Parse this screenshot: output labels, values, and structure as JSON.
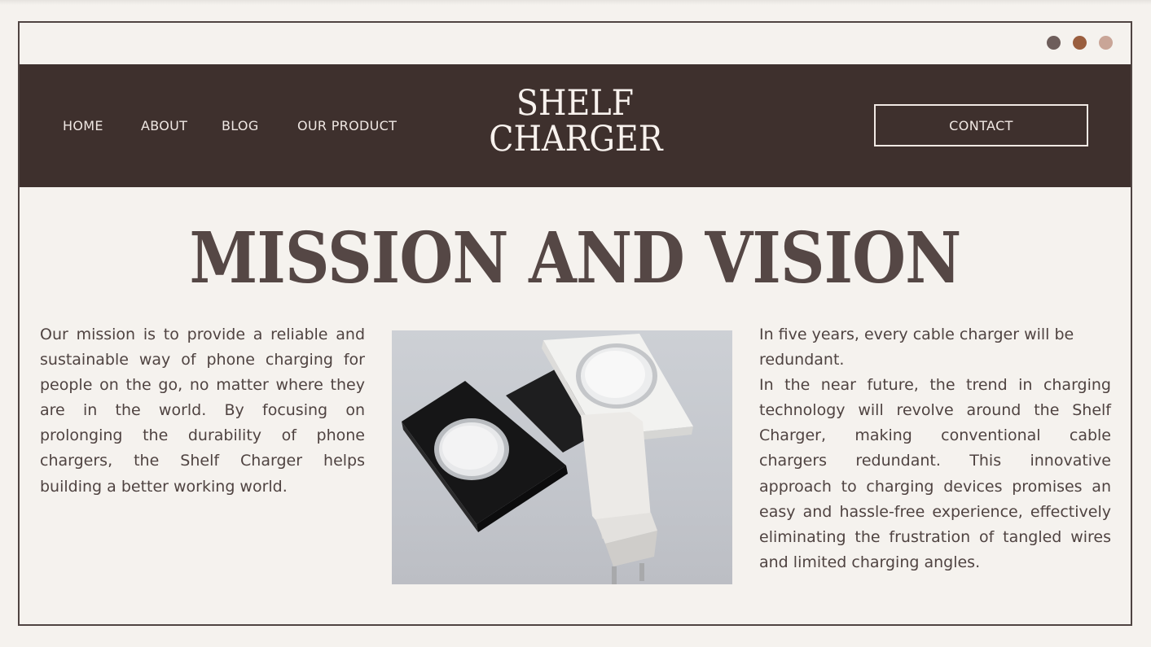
{
  "window": {
    "controls": [
      {
        "name": "control-dot-1",
        "color": "#6e5e5b"
      },
      {
        "name": "control-dot-2",
        "color": "#9a5e3e"
      },
      {
        "name": "control-dot-3",
        "color": "#c9a597"
      }
    ]
  },
  "nav": {
    "links": [
      "HOME",
      "ABOUT",
      "BLOG",
      "OUR PRODUCT"
    ],
    "logo_line1": "SHELF",
    "logo_line2": "CHARGER",
    "contact_label": "CONTACT"
  },
  "main": {
    "title": "MISSION AND VISION",
    "mission_text": "Our mission is to provide a reliable and sustainable way of phone charging for people on the go, no matter where they are in the world. By focusing on prolonging the durability of phone chargers, the Shelf Charger helps building a better working world.",
    "vision_line1": "In five years, every cable charger will be redundant.",
    "vision_line2": "In the near future, the trend in charging technology will revolve around the Shelf Charger, making conventional cable chargers redundant. This innovative approach to charging devices promises an easy and hassle-free experience, effectively eliminating the frustration of tangled wires and limited charging angles."
  },
  "colors": {
    "background": "#f5f2ee",
    "navbar": "#3e302d",
    "title": "#554745",
    "text": "#4f4341"
  },
  "icons": {
    "window_controls": "circle-dots",
    "product_photo": "product-photo"
  }
}
